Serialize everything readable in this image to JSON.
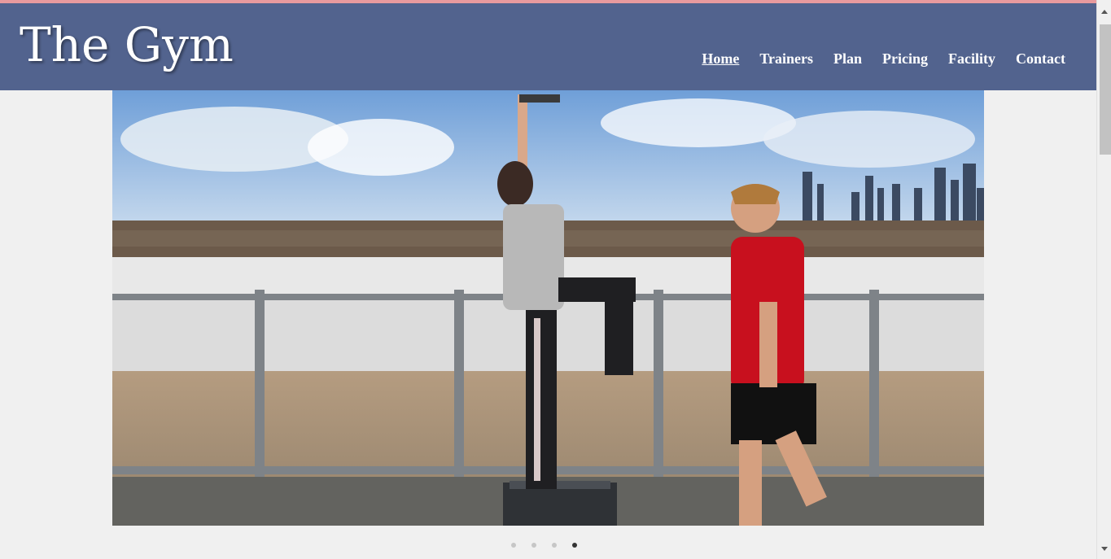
{
  "site": {
    "logo": "The Gym"
  },
  "nav": {
    "items": [
      {
        "label": "Home",
        "active": true
      },
      {
        "label": "Trainers",
        "active": false
      },
      {
        "label": "Plan",
        "active": false
      },
      {
        "label": "Pricing",
        "active": false
      },
      {
        "label": "Facility",
        "active": false
      },
      {
        "label": "Contact",
        "active": false
      }
    ]
  },
  "slider": {
    "slide_count": 4,
    "active_index": 3
  },
  "colors": {
    "header_bg": "#52638e",
    "top_strip": "#e89a9e",
    "page_bg": "#f0f0f0",
    "dot_active": "#333333",
    "dot_inactive": "#c6c6c6"
  },
  "icons": [
    "scroll-up-arrow-icon",
    "scroll-down-arrow-icon"
  ]
}
